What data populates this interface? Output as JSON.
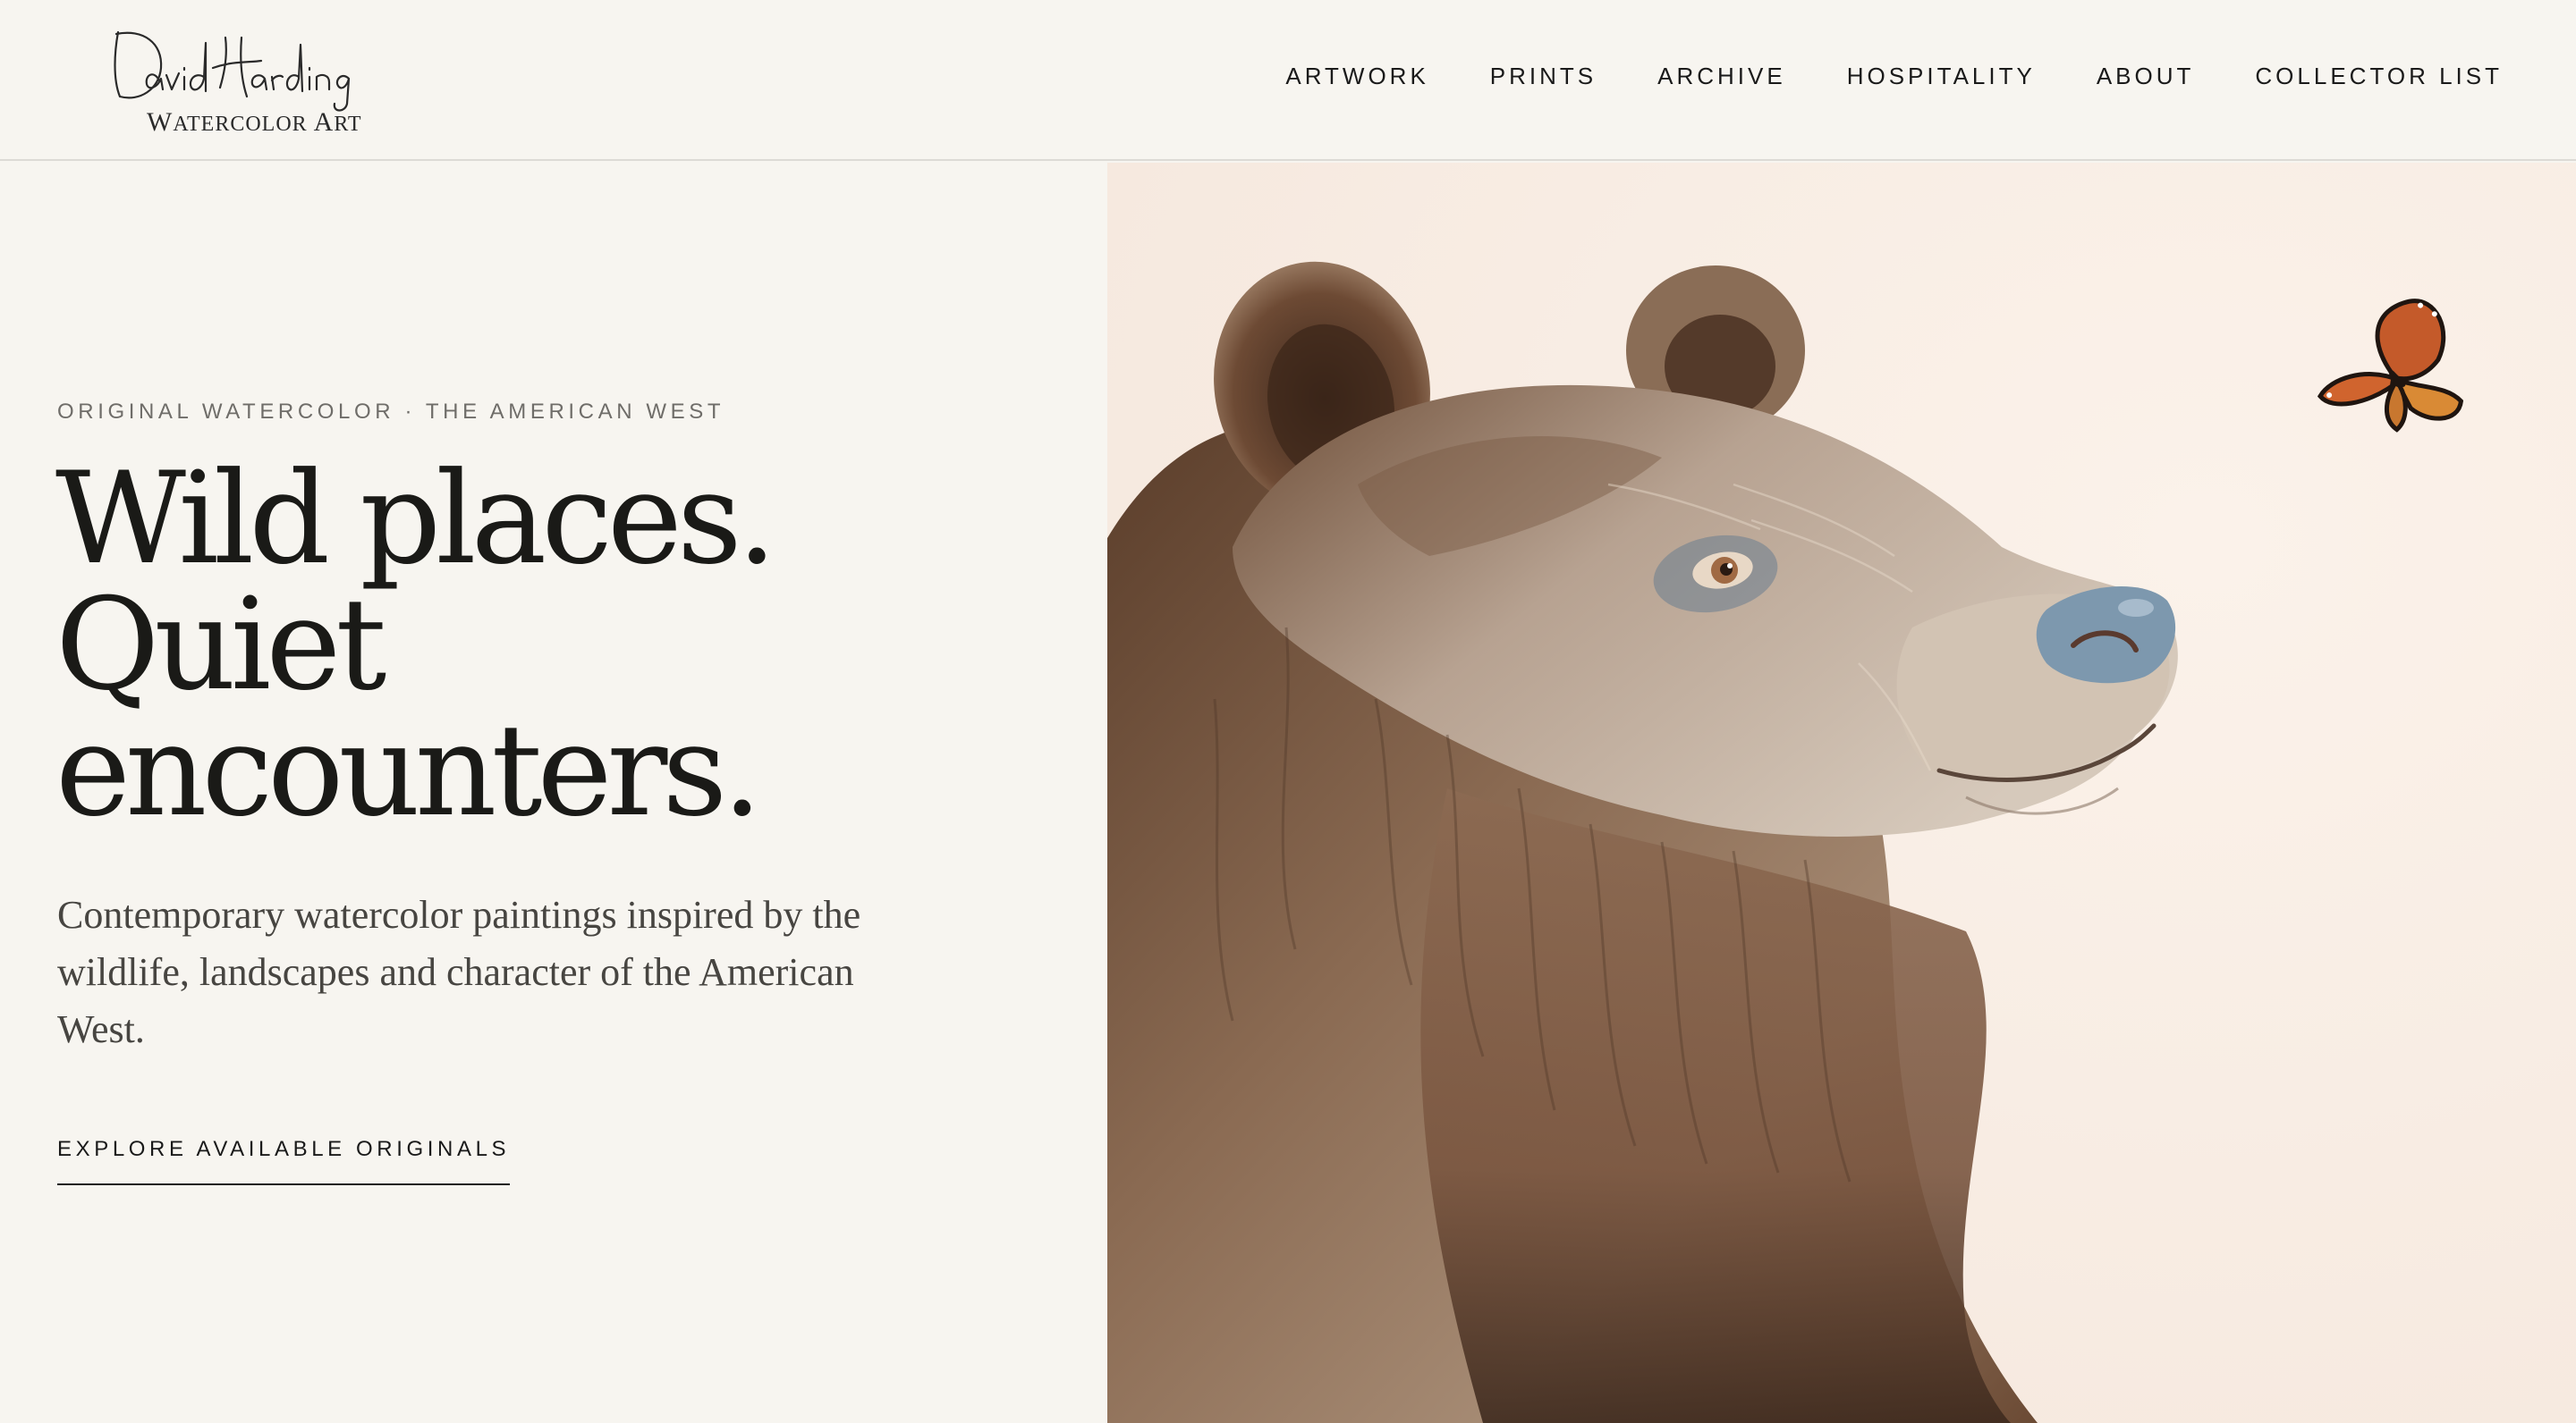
{
  "brand": {
    "signature": "David Harding",
    "subtitle_first": "W",
    "subtitle_rest": "ATERCOLOR ",
    "subtitle_cap2": "A",
    "subtitle_end": "RT"
  },
  "nav": {
    "items": [
      "ARTWORK",
      "PRINTS",
      "ARCHIVE",
      "HOSPITALITY",
      "ABOUT",
      "COLLECTOR LIST"
    ]
  },
  "hero": {
    "eyebrow": "ORIGINAL WATERCOLOR · THE AMERICAN WEST",
    "headline": [
      "Wild places.",
      "Quiet",
      "encounters."
    ],
    "subcopy": "Contemporary watercolor paintings inspired by the wildlife, landscapes and character of the American West.",
    "cta": "EXPLORE AVAILABLE ORIGINALS"
  },
  "artwork": {
    "subject": "watercolor painting of a brown bear looking up at a monarch butterfly",
    "icons": [
      "bear-illustration",
      "butterfly-illustration"
    ]
  },
  "colors": {
    "background": "#f7f5f0",
    "text": "#1a1a17",
    "muted": "#6f6d69",
    "art_background": "#f9eee6"
  }
}
